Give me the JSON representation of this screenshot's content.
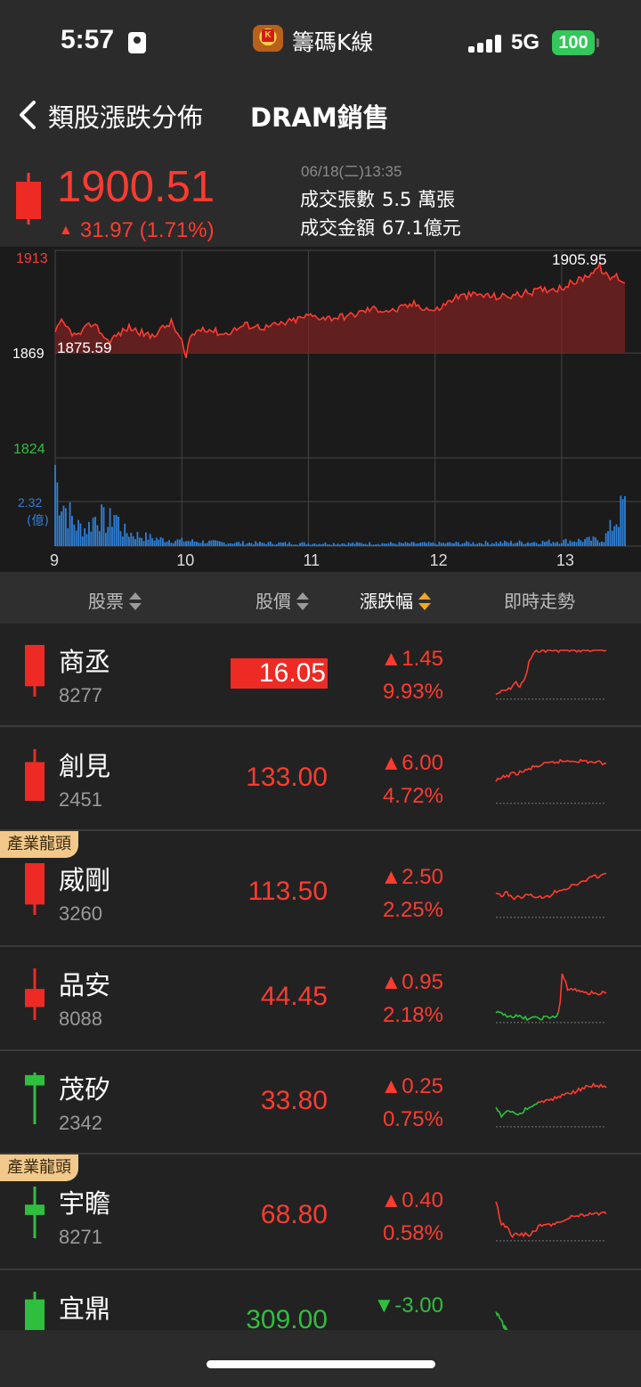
{
  "status_bar": {
    "time": "5:57",
    "app_name": "籌碼K線",
    "network": "5G",
    "battery": "100"
  },
  "nav": {
    "back_icon": "chevron-left-icon",
    "title": "類股漲跌分佈",
    "subtitle": "DRAM銷售"
  },
  "quote": {
    "price": "1900.51",
    "change": "31.97 (1.71%)",
    "datetime": "06/18(二)13:35",
    "volume_label": "成交張數",
    "volume_value": "5.5 萬張",
    "amount_label": "成交金額",
    "amount_value": "67.1億元",
    "up_color": "#ff3b30",
    "down_color": "#2fbf3f"
  },
  "chart_data": {
    "type": "line",
    "y_ticks": {
      "high": "1913",
      "mid": "1869",
      "low": "1824"
    },
    "open_label": "1875.59",
    "high_label": "1905.95",
    "volume_max_label": "2.32",
    "volume_unit": "(億)",
    "x_ticks": [
      "9",
      "10",
      "11",
      "12",
      "13"
    ],
    "ylim": [
      1824,
      1913
    ],
    "reference": 1869,
    "x_range_minutes": [
      0,
      270
    ],
    "price_anchor_points": [
      [
        0,
        1878
      ],
      [
        3,
        1882
      ],
      [
        10,
        1876
      ],
      [
        18,
        1882
      ],
      [
        25,
        1874
      ],
      [
        35,
        1880
      ],
      [
        45,
        1876
      ],
      [
        55,
        1882
      ],
      [
        60,
        1874
      ],
      [
        62,
        1866
      ],
      [
        64,
        1876
      ],
      [
        70,
        1880
      ],
      [
        80,
        1877
      ],
      [
        90,
        1881
      ],
      [
        100,
        1880
      ],
      [
        110,
        1882
      ],
      [
        120,
        1885
      ],
      [
        130,
        1884
      ],
      [
        140,
        1885
      ],
      [
        150,
        1888
      ],
      [
        160,
        1887
      ],
      [
        170,
        1890
      ],
      [
        180,
        1887
      ],
      [
        190,
        1893
      ],
      [
        200,
        1894
      ],
      [
        210,
        1893
      ],
      [
        220,
        1894
      ],
      [
        230,
        1896
      ],
      [
        240,
        1897
      ],
      [
        250,
        1901
      ],
      [
        258,
        1906
      ],
      [
        262,
        1901
      ],
      [
        266,
        1902
      ],
      [
        270,
        1899
      ]
    ],
    "volume_profile": [
      [
        0,
        0.95
      ],
      [
        5,
        0.55
      ],
      [
        10,
        0.3
      ],
      [
        15,
        0.25
      ],
      [
        20,
        0.48
      ],
      [
        25,
        0.3
      ],
      [
        28,
        0.5
      ],
      [
        32,
        0.22
      ],
      [
        40,
        0.15
      ],
      [
        50,
        0.1
      ],
      [
        60,
        0.08
      ],
      [
        80,
        0.05
      ],
      [
        120,
        0.04
      ],
      [
        180,
        0.04
      ],
      [
        230,
        0.06
      ],
      [
        260,
        0.1
      ],
      [
        269,
        0.55
      ]
    ],
    "colors": {
      "line": "#ff3b30",
      "fill": "#7a2222",
      "volume": "#2f7fd6",
      "grid": "#444444"
    }
  },
  "table": {
    "headers": {
      "stock": "股票",
      "price": "股價",
      "change": "漲跌幅",
      "trend": "即時走勢"
    },
    "rows": [
      {
        "tag": "",
        "name": "商丞",
        "code": "8277",
        "price": "16.05",
        "change": "▲1.45",
        "pct": "9.93%",
        "dir": "up",
        "highlight": true,
        "candle": {
          "type": "red",
          "wick_top": 0,
          "body_top": 0,
          "body_bottom": 0.8,
          "wick_bottom": 1
        },
        "spark": [
          [
            0,
            0.9
          ],
          [
            0.05,
            0.85
          ],
          [
            0.12,
            0.8
          ],
          [
            0.18,
            0.65
          ],
          [
            0.22,
            0.75
          ],
          [
            0.27,
            0.55
          ],
          [
            0.3,
            0.25
          ],
          [
            0.33,
            0.1
          ],
          [
            0.38,
            0.0
          ],
          [
            1,
            0.0
          ]
        ],
        "spark_down_until": 0
      },
      {
        "tag": "",
        "name": "創見",
        "code": "2451",
        "price": "133.00",
        "change": "▲6.00",
        "pct": "4.72%",
        "dir": "up",
        "highlight": false,
        "candle": {
          "type": "red",
          "wick_top": 0,
          "body_top": 0.25,
          "body_bottom": 1,
          "wick_bottom": 1
        },
        "spark": [
          [
            0,
            0.55
          ],
          [
            0.08,
            0.45
          ],
          [
            0.15,
            0.4
          ],
          [
            0.25,
            0.35
          ],
          [
            0.35,
            0.25
          ],
          [
            0.45,
            0.2
          ],
          [
            0.55,
            0.15
          ],
          [
            0.7,
            0.12
          ],
          [
            0.85,
            0.15
          ],
          [
            1,
            0.18
          ]
        ],
        "spark_down_until": 0
      },
      {
        "tag": "產業龍頭",
        "name": "威剛",
        "code": "3260",
        "price": "113.50",
        "change": "▲2.50",
        "pct": "2.25%",
        "dir": "up",
        "highlight": false,
        "candle": {
          "type": "red",
          "wick_top": 0,
          "body_top": 0,
          "body_bottom": 0.8,
          "wick_bottom": 1
        },
        "spark": [
          [
            0,
            0.5
          ],
          [
            0.05,
            0.55
          ],
          [
            0.1,
            0.5
          ],
          [
            0.15,
            0.6
          ],
          [
            0.3,
            0.55
          ],
          [
            0.45,
            0.6
          ],
          [
            0.55,
            0.45
          ],
          [
            0.65,
            0.4
          ],
          [
            0.75,
            0.3
          ],
          [
            0.85,
            0.2
          ],
          [
            1,
            0.1
          ]
        ],
        "spark_down_until": 0
      },
      {
        "tag": "",
        "name": "品安",
        "code": "8088",
        "price": "44.45",
        "change": "▲0.95",
        "pct": "2.18%",
        "dir": "up",
        "highlight": false,
        "candle": {
          "type": "red",
          "wick_top": 0,
          "body_top": 0.4,
          "body_bottom": 0.75,
          "wick_bottom": 1
        },
        "spark": [
          [
            0,
            0.8
          ],
          [
            0.1,
            0.85
          ],
          [
            0.3,
            0.92
          ],
          [
            0.45,
            0.9
          ],
          [
            0.55,
            0.88
          ],
          [
            0.58,
            0.7
          ],
          [
            0.6,
            0.0
          ],
          [
            0.65,
            0.3
          ],
          [
            0.75,
            0.35
          ],
          [
            0.85,
            0.4
          ],
          [
            1,
            0.4
          ]
        ],
        "spark_down_until": 0.57
      },
      {
        "tag": "",
        "name": "茂矽",
        "code": "2342",
        "price": "33.80",
        "change": "▲0.25",
        "pct": "0.75%",
        "dir": "up",
        "highlight": false,
        "candle": {
          "type": "green",
          "wick_top": 0,
          "body_top": 0.05,
          "body_bottom": 0.25,
          "wick_bottom": 1
        },
        "spark": [
          [
            0,
            0.6
          ],
          [
            0.05,
            0.8
          ],
          [
            0.1,
            0.65
          ],
          [
            0.2,
            0.75
          ],
          [
            0.3,
            0.6
          ],
          [
            0.4,
            0.5
          ],
          [
            0.5,
            0.45
          ],
          [
            0.6,
            0.35
          ],
          [
            0.7,
            0.3
          ],
          [
            0.8,
            0.2
          ],
          [
            0.9,
            0.15
          ],
          [
            1,
            0.2
          ]
        ],
        "spark_down_until": 0.4
      },
      {
        "tag": "產業龍頭",
        "name": "宇瞻",
        "code": "8271",
        "price": "68.80",
        "change": "▲0.40",
        "pct": "0.58%",
        "dir": "up",
        "highlight": false,
        "candle": {
          "type": "green",
          "wick_top": 0,
          "body_top": 0.35,
          "body_bottom": 0.55,
          "wick_bottom": 1
        },
        "spark": [
          [
            0,
            0.2
          ],
          [
            0.05,
            0.65
          ],
          [
            0.1,
            0.7
          ],
          [
            0.15,
            0.9
          ],
          [
            0.2,
            0.85
          ],
          [
            0.3,
            0.88
          ],
          [
            0.4,
            0.7
          ],
          [
            0.55,
            0.65
          ],
          [
            0.7,
            0.5
          ],
          [
            0.85,
            0.45
          ],
          [
            1,
            0.45
          ]
        ],
        "spark_down_until": 0
      },
      {
        "tag": "",
        "name": "宜鼎",
        "code": "",
        "price": "309.00",
        "change": "▼-3.00",
        "pct": "",
        "dir": "down",
        "highlight": false,
        "candle": {
          "type": "green",
          "wick_top": 0,
          "body_top": 0.15,
          "body_bottom": 0.9,
          "wick_bottom": 1
        },
        "spark": [
          [
            0,
            0.3
          ],
          [
            0.05,
            0.5
          ],
          [
            0.1,
            0.7
          ],
          [
            0.2,
            0.9
          ],
          [
            0.35,
            0.95
          ]
        ],
        "spark_down_until": 0.4
      }
    ]
  }
}
